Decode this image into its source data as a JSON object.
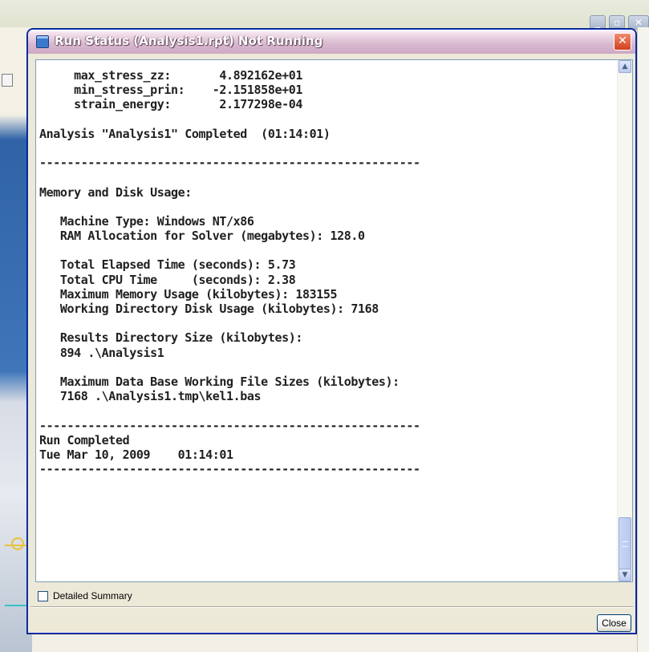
{
  "dialog": {
    "title": "Run Status (Analysis1.rpt) Not Running",
    "close_icon": "close-icon",
    "log_lines": [
      "     max_stress_zz:       4.892162e+01",
      "     min_stress_prin:    -2.151858e+01",
      "     strain_energy:       2.177298e-04",
      "",
      "Analysis \"Analysis1\" Completed  (01:14:01)",
      "",
      "-------------------------------------------------------",
      "",
      "Memory and Disk Usage:",
      "",
      "   Machine Type: Windows NT/x86",
      "   RAM Allocation for Solver (megabytes): 128.0",
      "",
      "   Total Elapsed Time (seconds): 5.73",
      "   Total CPU Time     (seconds): 2.38",
      "   Maximum Memory Usage (kilobytes): 183155",
      "   Working Directory Disk Usage (kilobytes): 7168",
      "",
      "   Results Directory Size (kilobytes):",
      "   894 .\\Analysis1",
      "",
      "   Maximum Data Base Working File Sizes (kilobytes):",
      "   7168 .\\Analysis1.tmp\\kel1.bas",
      "",
      "-------------------------------------------------------",
      "Run Completed",
      "Tue Mar 10, 2009    01:14:01",
      "-------------------------------------------------------"
    ],
    "detailed_summary_label": "Detailed Summary",
    "detailed_summary_checked": false,
    "close_button_label": "Close"
  },
  "background_window": {
    "buttons": [
      "minimize-icon",
      "restore-icon",
      "close-icon"
    ]
  }
}
